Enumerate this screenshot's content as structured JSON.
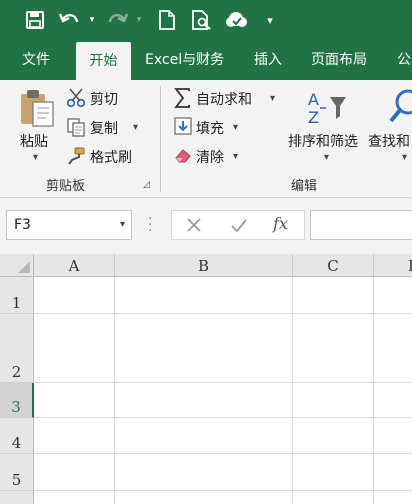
{
  "ribbon_tabs": [
    {
      "label": "文件"
    },
    {
      "label": "开始"
    },
    {
      "label": "Excel与财务"
    },
    {
      "label": "插入"
    },
    {
      "label": "页面布局"
    },
    {
      "label": "公"
    }
  ],
  "clipboard": {
    "paste": "粘贴",
    "cut": "剪切",
    "copy": "复制",
    "format_painter": "格式刷",
    "group_label": "剪贴板"
  },
  "editing": {
    "autosum": "自动求和",
    "fill": "填充",
    "clear": "清除",
    "sort_filter": "排序和筛选",
    "find": "查找和",
    "group_label": "编辑"
  },
  "formula_bar": {
    "name_box": "F3",
    "fx": "fx",
    "formula": ""
  },
  "columns": [
    "A",
    "B",
    "C",
    "I"
  ],
  "rows": [
    "1",
    "2",
    "3",
    "4",
    "5"
  ],
  "selected_row": "3",
  "colors": {
    "brand": "#217346",
    "ribbon_bg": "#f3f3f3"
  }
}
